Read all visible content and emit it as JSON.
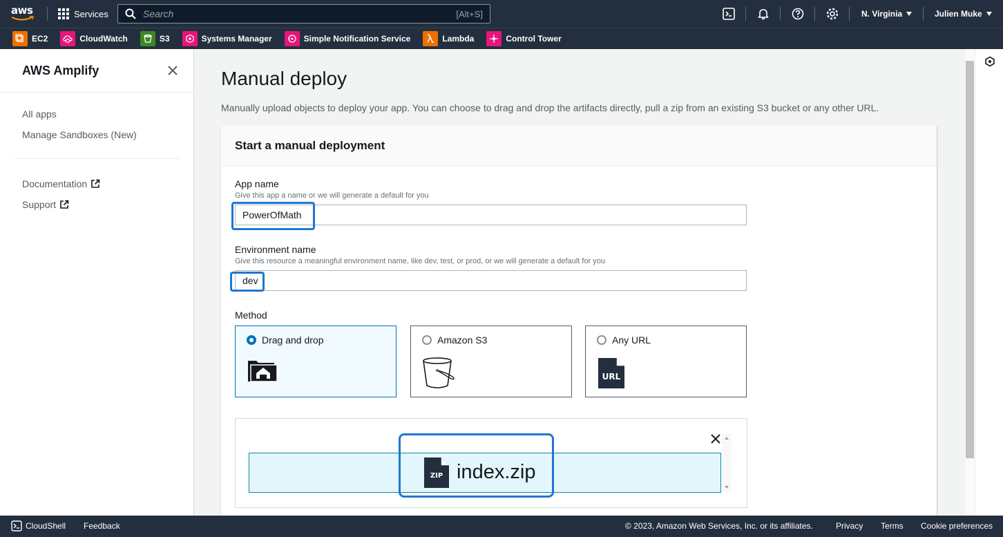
{
  "topnav": {
    "logo_text": "aws",
    "services_label": "Services",
    "search_placeholder": "Search",
    "search_shortcut": "[Alt+S]",
    "region": "N. Virginia",
    "user": "Julien Muke",
    "icons": [
      "cloudshell-icon",
      "bell-icon",
      "help-icon",
      "settings-icon"
    ]
  },
  "favorites": [
    {
      "label": "EC2",
      "color": "#ed7100",
      "icon": "ec2-icon"
    },
    {
      "label": "CloudWatch",
      "color": "#e7157b",
      "icon": "cloudwatch-icon"
    },
    {
      "label": "S3",
      "color": "#3f8624",
      "icon": "s3-icon"
    },
    {
      "label": "Systems Manager",
      "color": "#e7157b",
      "icon": "systems-manager-icon"
    },
    {
      "label": "Simple Notification Service",
      "color": "#e7157b",
      "icon": "sns-icon"
    },
    {
      "label": "Lambda",
      "color": "#ed7100",
      "icon": "lambda-icon"
    },
    {
      "label": "Control Tower",
      "color": "#e7157b",
      "icon": "control-tower-icon"
    }
  ],
  "sidebar": {
    "title": "AWS Amplify",
    "items": [
      {
        "label": "All apps"
      },
      {
        "label": "Manage Sandboxes (New)"
      },
      {
        "label": "Documentation"
      },
      {
        "label": "Support"
      }
    ]
  },
  "main": {
    "title": "Manual deploy",
    "description": "Manually upload objects to deploy your app. You can choose to drag and drop the artifacts directly, pull a zip from an existing S3 bucket or any other URL.",
    "panel_title": "Start a manual deployment",
    "app_name": {
      "label": "App name",
      "hint": "Give this app a name or we will generate a default for you",
      "value": "PowerOfMath"
    },
    "env_name": {
      "label": "Environment name",
      "hint": "Give this resource a meaningful environment name, like dev, test, or prod, or we will generate a default for you",
      "value": "dev"
    },
    "method": {
      "label": "Method",
      "options": [
        {
          "label": "Drag and drop",
          "selected": true,
          "icon": "folder-upload-icon"
        },
        {
          "label": "Amazon S3",
          "selected": false,
          "icon": "bucket-icon"
        },
        {
          "label": "Any URL",
          "selected": false,
          "icon": "url-file-icon",
          "icon_text": "URL"
        }
      ]
    },
    "upload": {
      "file_name": "index.zip",
      "file_icon_text": "ZIP"
    }
  },
  "footer": {
    "cloudshell": "CloudShell",
    "feedback": "Feedback",
    "copyright": "© 2023, Amazon Web Services, Inc. or its affiliates.",
    "privacy": "Privacy",
    "terms": "Terms",
    "cookie": "Cookie preferences"
  },
  "colors": {
    "nav_bg": "#232f3e",
    "accent": "#0073bb",
    "annotation": "#1f76d2"
  }
}
